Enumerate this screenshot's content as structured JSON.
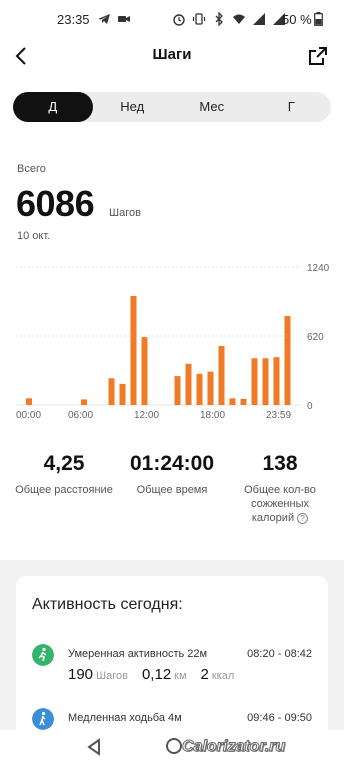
{
  "status_bar": {
    "time": "23:35",
    "battery_pct": "50 %"
  },
  "header": {
    "title": "Шаги",
    "back_icon": "chevron-left-icon",
    "export_icon": "export-icon"
  },
  "tabs": [
    {
      "label": "Д",
      "active": true
    },
    {
      "label": "Нед",
      "active": false
    },
    {
      "label": "Мес",
      "active": false
    },
    {
      "label": "Г",
      "active": false
    }
  ],
  "summary": {
    "total_label": "Всего",
    "total_value": "6086",
    "unit": "Шагов",
    "date": "10 окт."
  },
  "chart_data": {
    "type": "bar",
    "color": "#f07a26",
    "x_ticks": [
      "00:00",
      "06:00",
      "12:00",
      "18:00",
      "23:59"
    ],
    "y_ticks": [
      "1240",
      "620",
      "0"
    ],
    "ylim": [
      0,
      1240
    ],
    "x_units": "hours",
    "bars": [
      {
        "hour": 1,
        "value": 60
      },
      {
        "hour": 6,
        "value": 50
      },
      {
        "hour": 8.5,
        "value": 240
      },
      {
        "hour": 9.5,
        "value": 190
      },
      {
        "hour": 10.5,
        "value": 980
      },
      {
        "hour": 11.5,
        "value": 610
      },
      {
        "hour": 14.5,
        "value": 260
      },
      {
        "hour": 15.5,
        "value": 370
      },
      {
        "hour": 16.5,
        "value": 280
      },
      {
        "hour": 17.5,
        "value": 300
      },
      {
        "hour": 18.5,
        "value": 530
      },
      {
        "hour": 19.5,
        "value": 60
      },
      {
        "hour": 20.5,
        "value": 55
      },
      {
        "hour": 21.5,
        "value": 420
      },
      {
        "hour": 22.5,
        "value": 420
      },
      {
        "hour": 23.5,
        "value": 430
      },
      {
        "hour": 24.5,
        "value": 800
      }
    ]
  },
  "stats": [
    {
      "value": "4,25",
      "label": "Общее расстояние"
    },
    {
      "value": "01:24:00",
      "label": "Общее время"
    },
    {
      "value": "138",
      "label": "Общее кол-во сожженных калорий"
    }
  ],
  "activity": {
    "title": "Активность сегодня",
    "items": [
      {
        "name": "Умеренная активность 22м",
        "time": "08:20 - 08:42",
        "steps": "190",
        "steps_unit": "Шагов",
        "km": "0,12",
        "km_unit": "км",
        "kcal": "2",
        "kcal_unit": "ккал",
        "icon": "running-person-icon",
        "color": "#35b36a"
      },
      {
        "name": "Медленная ходьба 4м",
        "time": "09:46 - 09:50",
        "icon": "walking-person-icon",
        "color": "#3b8fd9"
      }
    ]
  },
  "watermark": "Calorizator.ru"
}
